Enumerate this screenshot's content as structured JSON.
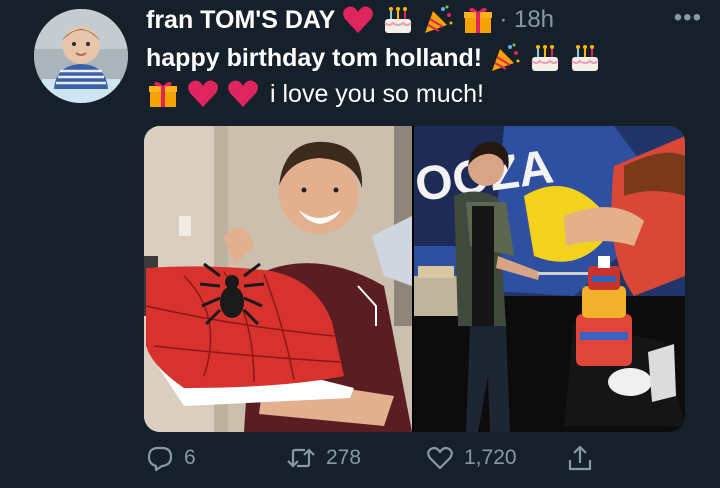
{
  "tweet": {
    "display_name": "fran TOM'S DAY",
    "time": "· 18h",
    "more_label": "•••",
    "line2_text": "happy birthday tom holland!",
    "line3_text": "i love you so much!",
    "name_emojis": [
      "red-heart",
      "birthday-cake",
      "party-popper",
      "wrapped-gift"
    ],
    "line2_emojis": [
      "party-popper",
      "birthday-cake",
      "birthday-cake"
    ],
    "line3_emojis": [
      "wrapped-gift",
      "red-heart",
      "red-heart"
    ]
  },
  "actions": {
    "replies": "6",
    "retweets": "278",
    "likes": "1,720"
  },
  "colors": {
    "background": "#15202b",
    "muted": "#8899a6",
    "heart": "#e0245e"
  }
}
